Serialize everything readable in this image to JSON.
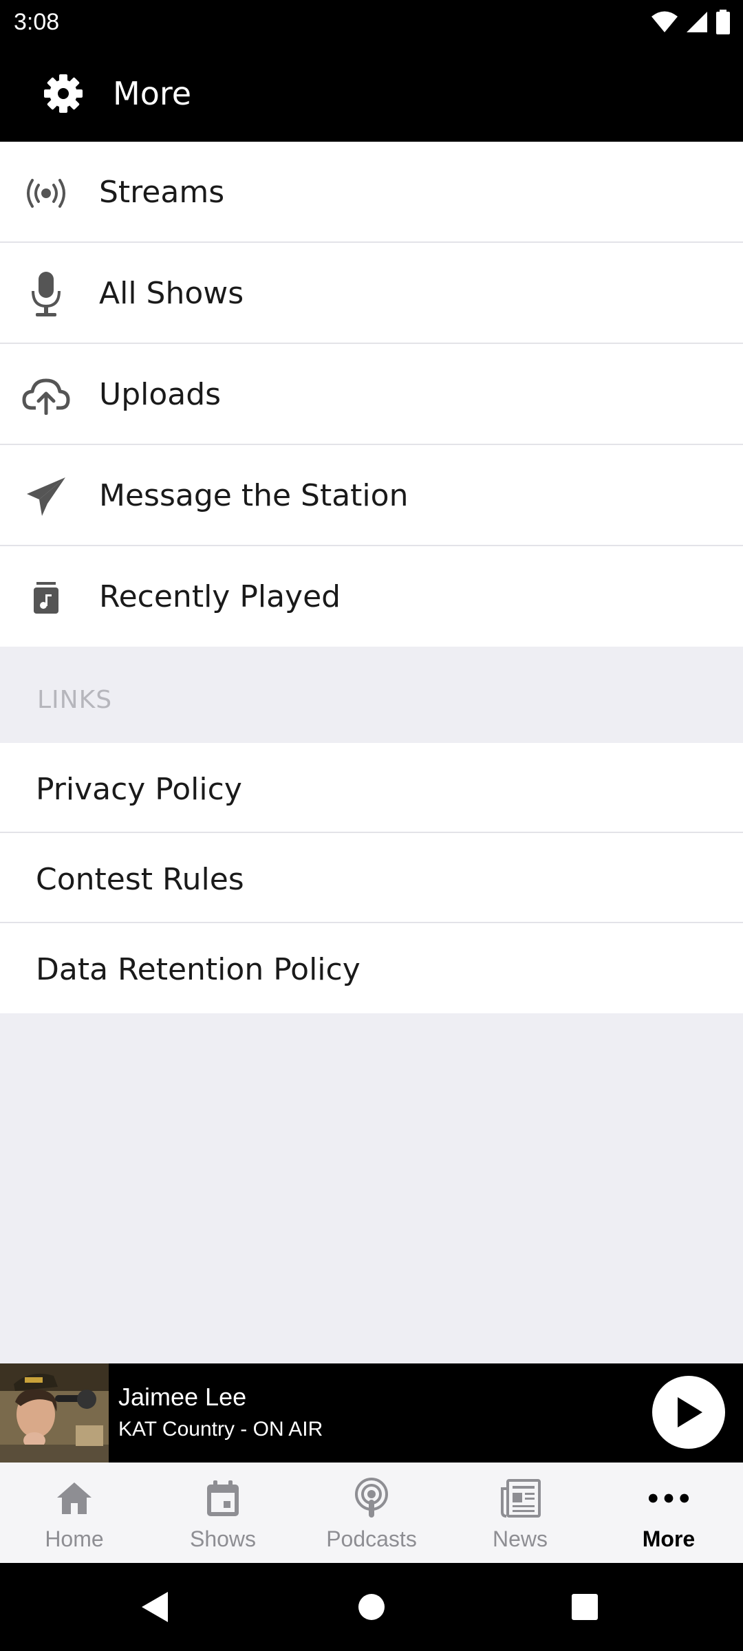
{
  "status_bar": {
    "time": "3:08"
  },
  "app_bar": {
    "title": "More",
    "icon": "gear-icon"
  },
  "menu": {
    "items": [
      {
        "label": "Streams",
        "icon": "broadcast-icon"
      },
      {
        "label": "All Shows",
        "icon": "microphone-icon"
      },
      {
        "label": "Uploads",
        "icon": "cloud-upload-icon"
      },
      {
        "label": "Message the Station",
        "icon": "paper-plane-icon"
      },
      {
        "label": "Recently Played",
        "icon": "music-note-icon"
      }
    ]
  },
  "links": {
    "header": "LINKS",
    "items": [
      {
        "label": "Privacy Policy"
      },
      {
        "label": "Contest Rules"
      },
      {
        "label": "Data Retention Policy"
      }
    ]
  },
  "now_playing": {
    "title": "Jaimee Lee",
    "subtitle": "KAT Country - ON AIR",
    "play_icon": "play-icon"
  },
  "tabs": [
    {
      "label": "Home",
      "icon": "home-icon",
      "active": false
    },
    {
      "label": "Shows",
      "icon": "calendar-icon",
      "active": false
    },
    {
      "label": "Podcasts",
      "icon": "podcast-icon",
      "active": false
    },
    {
      "label": "News",
      "icon": "newspaper-icon",
      "active": false
    },
    {
      "label": "More",
      "icon": "more-dots-icon",
      "active": true
    }
  ],
  "colors": {
    "bar_background": "#000000",
    "list_background": "#ffffff",
    "page_background": "#eeeef3",
    "inactive_tab": "#8e8e93",
    "active_tab": "#000000"
  }
}
